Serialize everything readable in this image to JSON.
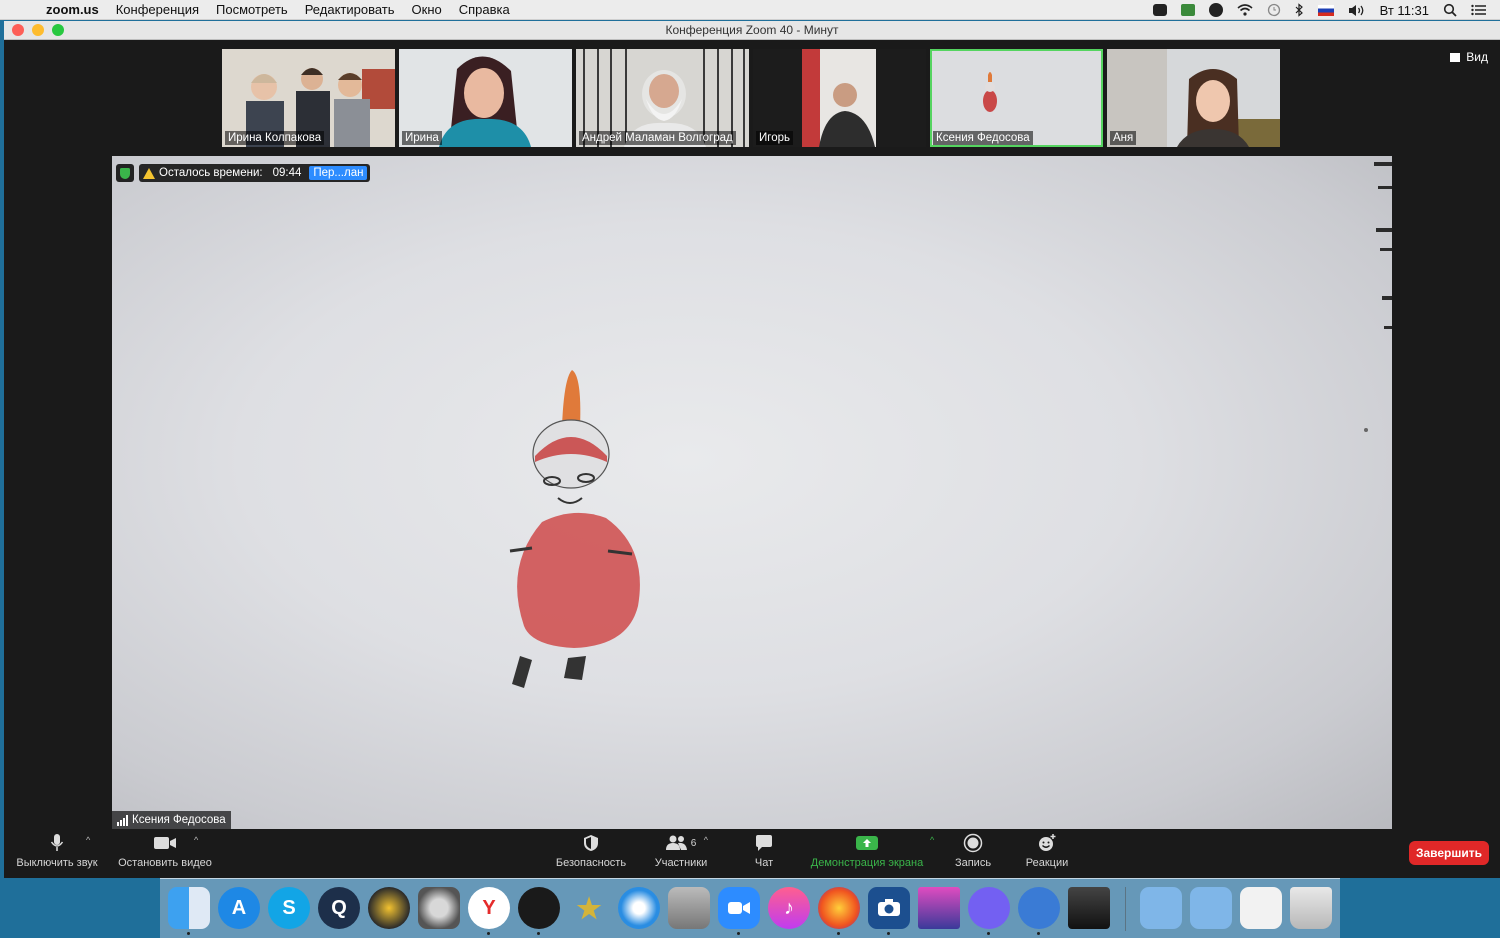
{
  "menubar": {
    "app": "zoom.us",
    "items": [
      "Конференция",
      "Посмотреть",
      "Редактировать",
      "Окно",
      "Справка"
    ],
    "clock": "Вт 11:31",
    "status_icons": [
      "zoom-icon",
      "download-icon",
      "viber-icon",
      "wifi-icon",
      "time-machine-icon",
      "bluetooth-icon",
      "russian-flag-icon",
      "volume-icon",
      "search-icon",
      "list-icon"
    ]
  },
  "window": {
    "title": "Конференция Zoom   40 - Минут"
  },
  "gallery": {
    "view_label": "Вид",
    "participants": [
      {
        "name": "Ирина Колпакова",
        "active": false
      },
      {
        "name": "Ирина",
        "active": false
      },
      {
        "name": "Андрей Маламан Волгоград",
        "active": false
      },
      {
        "name": "Игорь",
        "active": false
      },
      {
        "name": "Ксения Федосова",
        "active": true
      },
      {
        "name": "Аня",
        "active": false
      }
    ]
  },
  "main_video": {
    "timer_label": "Осталось времени:",
    "timer_value": "09:44",
    "upgrade_label": "Пер...лан",
    "speaker": "Ксения Федосова"
  },
  "toolbar": {
    "mute": "Выключить звук",
    "video": "Остановить видео",
    "security": "Безопасность",
    "participants": "Участники",
    "participants_count": "6",
    "chat": "Чат",
    "share": "Демонстрация экрана",
    "record": "Запись",
    "reactions": "Реакции",
    "end": "Завершить"
  },
  "dock": {
    "apps": [
      "finder-icon",
      "app-store-icon",
      "skype-icon",
      "quicktime-icon",
      "burn-icon",
      "system-preferences-icon",
      "yandex-browser-icon",
      "launchpad-icon",
      "ilife-star-icon",
      "safari-icon",
      "disk-utility-icon",
      "zoom-icon",
      "itunes-icon",
      "firefox-icon",
      "photo-booth-icon",
      "imac-icon",
      "viber-icon",
      "mail-icon",
      "printer-icon",
      "documents-folder-icon",
      "downloads-folder-icon",
      "preview-icon",
      "trash-icon"
    ]
  },
  "colors": {
    "share_green": "#3ab54a",
    "end_red": "#e02828",
    "active_tile": "#55d460",
    "upgrade_blue": "#2d8cff"
  }
}
